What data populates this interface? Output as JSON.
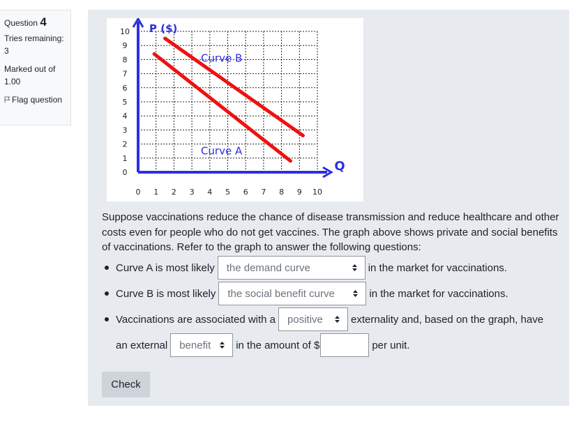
{
  "info": {
    "question_label": "Question",
    "question_number": "4",
    "tries_label": "Tries remaining:",
    "tries_value": "3",
    "marked_label": "Marked out of",
    "marked_value": "1.00",
    "flag_label": "Flag question"
  },
  "graph": {
    "y_axis_label": "P ($)",
    "x_axis_label": "Q",
    "y_ticks": [
      "10",
      "9",
      "8",
      "7",
      "6",
      "5",
      "4",
      "3",
      "2",
      "1",
      "0"
    ],
    "x_ticks": [
      "0",
      "1",
      "2",
      "3",
      "4",
      "5",
      "6",
      "7",
      "8",
      "9",
      "10"
    ],
    "curve_b_label": "Curve B",
    "curve_a_label": "Curve A",
    "axis_color": "#2f2fe0",
    "curve_color": "#ee1111"
  },
  "question_text": "Suppose vaccinations reduce the chance of disease transmission and reduce healthcare and other costs even for people who do not get vaccines. The graph above shows private and social benefits of vaccinations. Refer to the graph to answer the following questions:",
  "items": {
    "a_prefix": "Curve A is most likely",
    "a_select": "the demand curve",
    "a_suffix": "in the market for vaccinations.",
    "b_prefix": "Curve B is most likely",
    "b_select": "the social benefit curve",
    "b_suffix": "in the market for vaccinations.",
    "c_prefix": "Vaccinations are associated with a",
    "c_select": "positive",
    "c_suffix": "externality and, based on the graph, have",
    "d_prefix": "an external",
    "d_select": "benefit",
    "d_middle": "in the amount of $",
    "d_input": "",
    "d_suffix": "per unit."
  },
  "check_label": "Check"
}
